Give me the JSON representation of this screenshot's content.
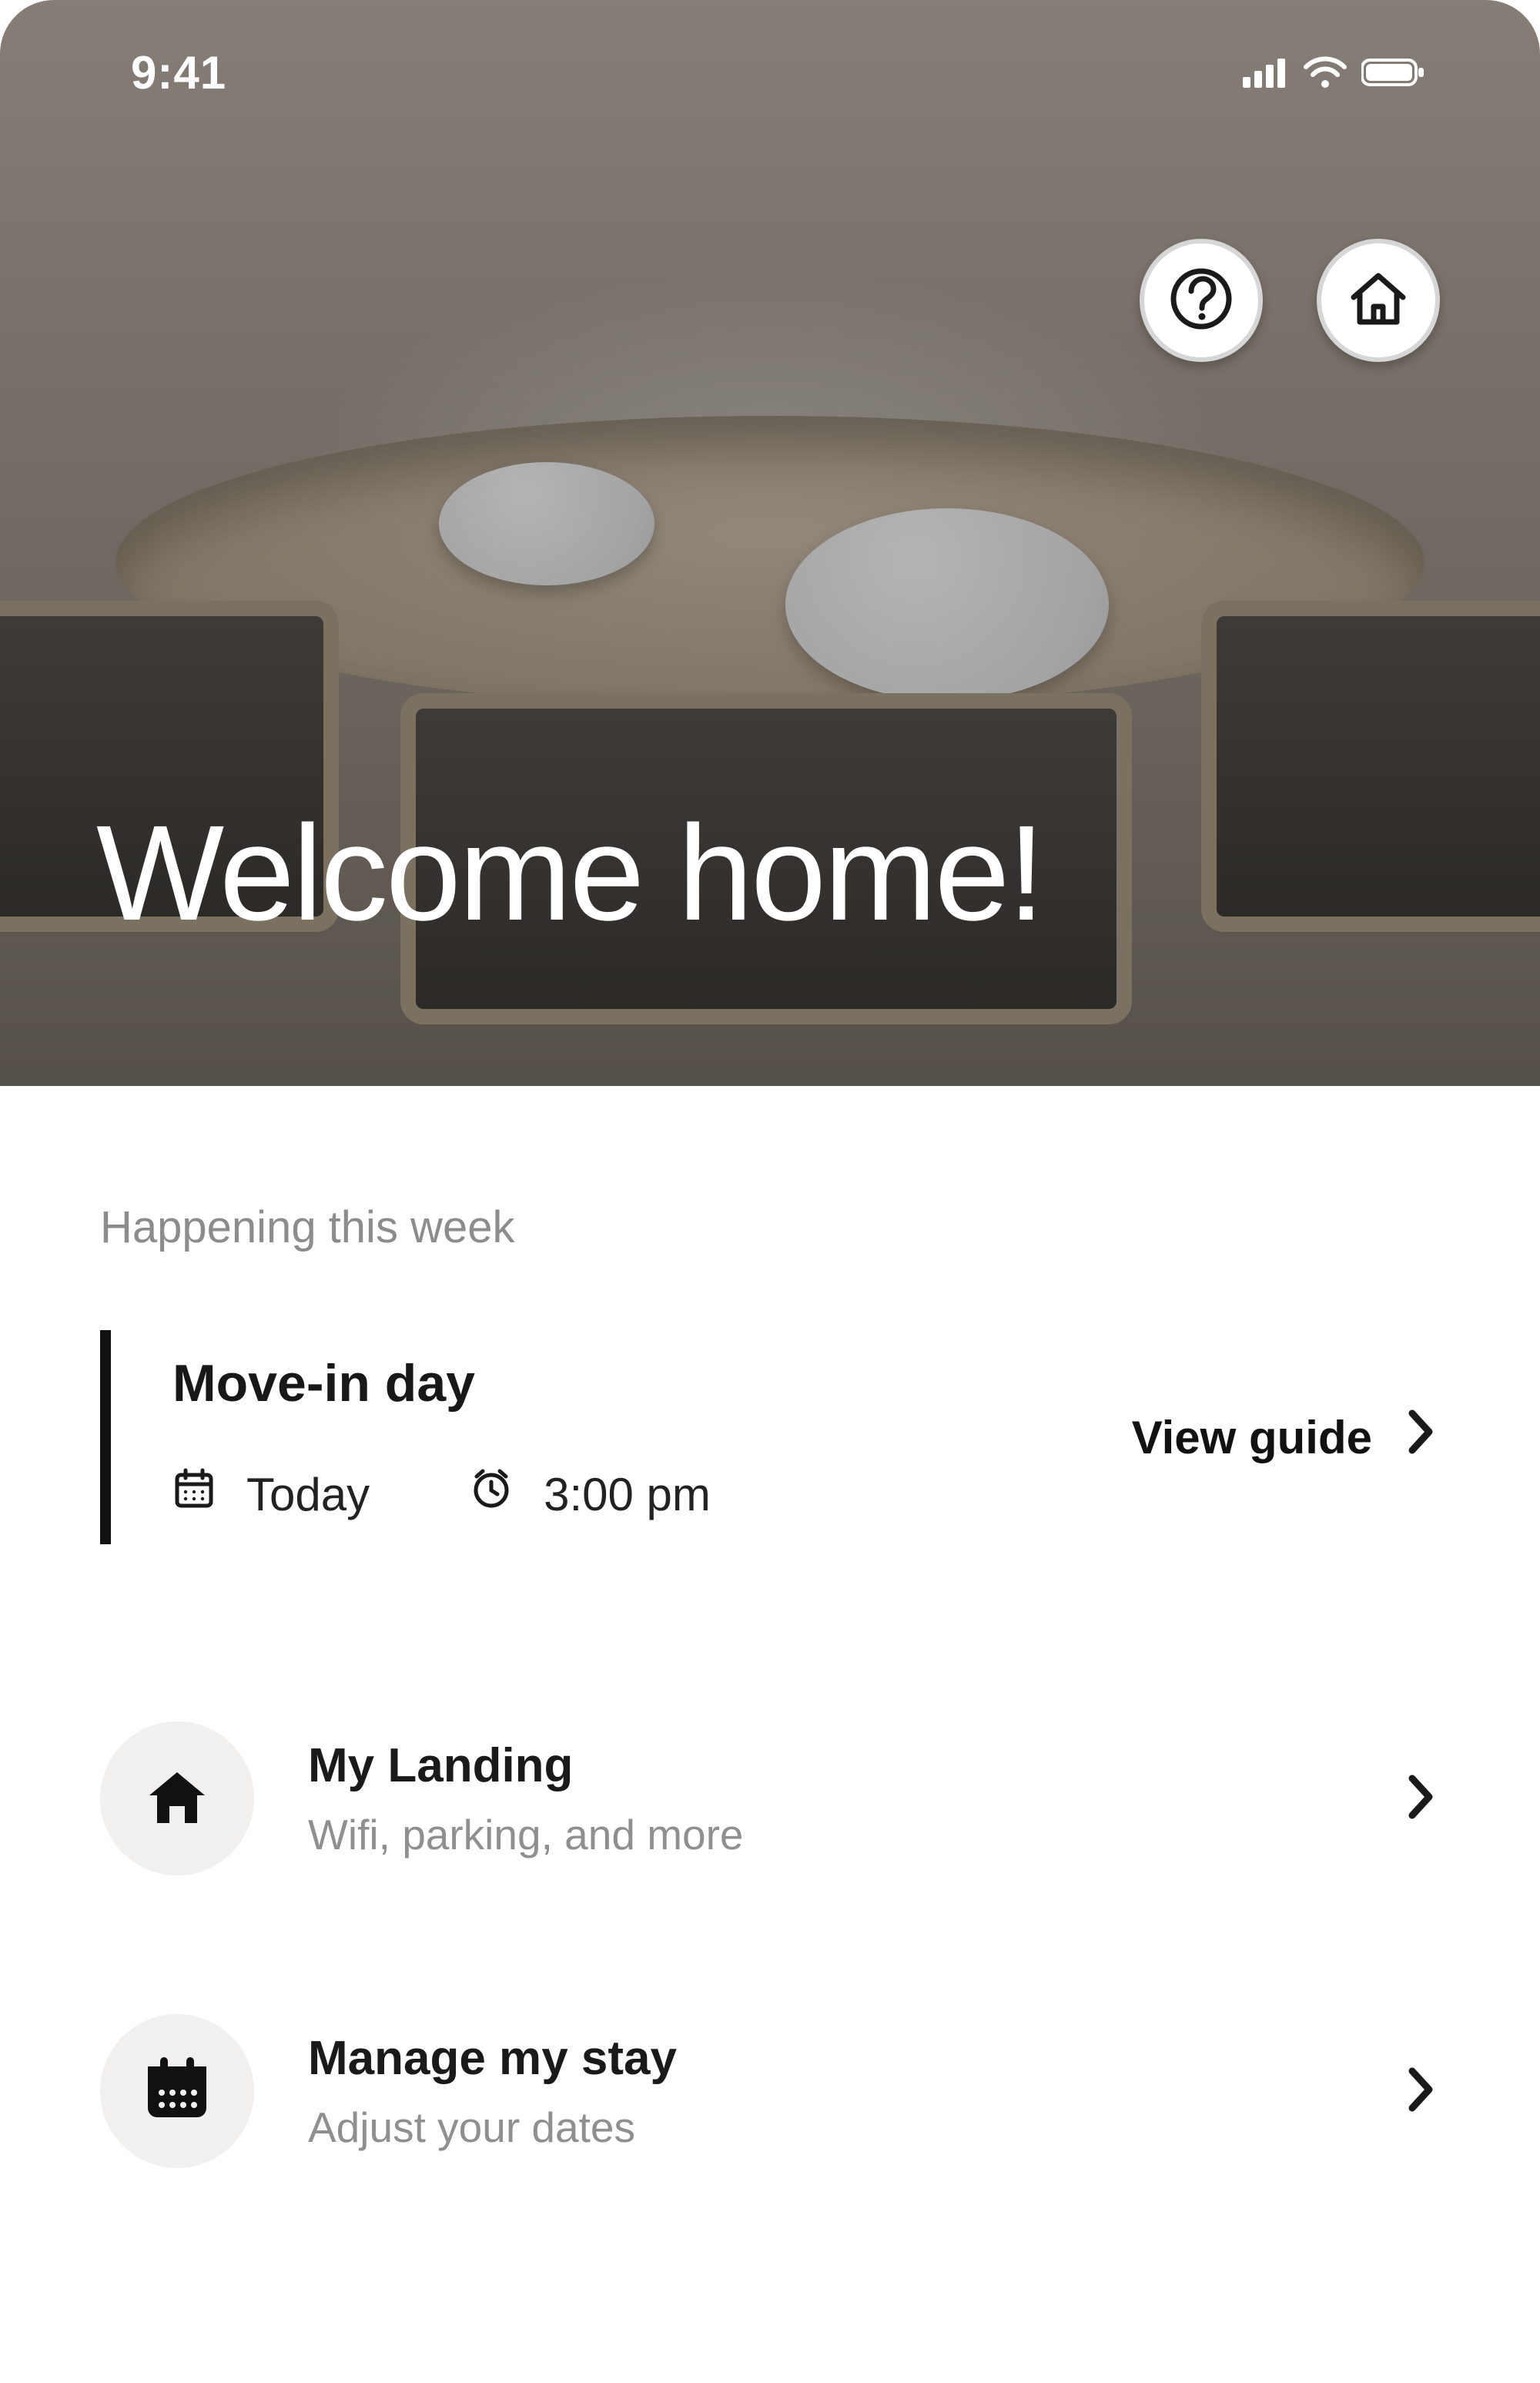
{
  "status_bar": {
    "time": "9:41"
  },
  "hero": {
    "title": "Welcome home!"
  },
  "section_label": "Happening this week",
  "event": {
    "title": "Move-in day",
    "date_label": "Today",
    "time_label": "3:00 pm",
    "action_label": "View guide"
  },
  "menu": [
    {
      "icon": "home-icon",
      "title": "My Landing",
      "subtitle": "Wifi, parking, and more"
    },
    {
      "icon": "calendar-filled-icon",
      "title": "Manage my stay",
      "subtitle": "Adjust your dates"
    }
  ]
}
